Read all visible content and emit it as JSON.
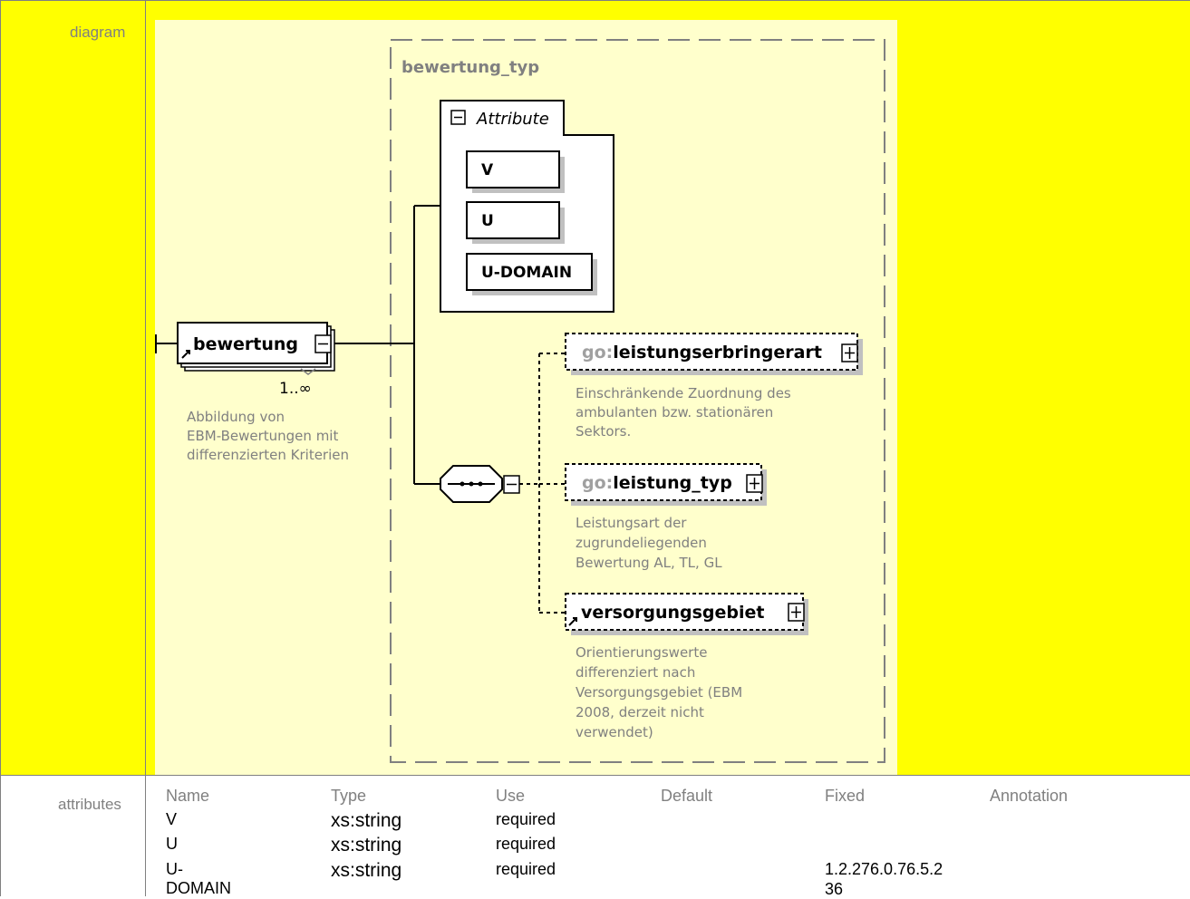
{
  "rows": {
    "diagram_label": "diagram",
    "attributes_label": "attributes"
  },
  "diagram": {
    "group_label": "bewertung_typ",
    "attribute_group_label": "Attribute",
    "attributes": [
      "V",
      "U",
      "U-DOMAIN"
    ],
    "root_element": "bewertung",
    "root_multiplicity": "1..∞",
    "root_annotation": [
      "Abbildung von",
      "EBM-Bewertungen mit",
      "differenzierten Kriterien"
    ],
    "children": [
      {
        "prefix": "go:",
        "name": "leistungserbringerart",
        "annotation": [
          "Einschränkende Zuordnung des",
          "ambulanten bzw. stationären",
          "Sektors."
        ]
      },
      {
        "prefix": "go:",
        "name": "leistung_typ",
        "annotation": [
          "Leistungsart der",
          "zugrundeliegenden",
          "Bewertung AL, TL, GL"
        ]
      },
      {
        "prefix": "",
        "name": "versorgungsgebiet",
        "annotation": [
          "Orientierungswerte",
          "differenziert nach",
          "Versorgungsgebiet (EBM",
          "2008, derzeit nicht",
          "verwendet)"
        ]
      }
    ],
    "colors": {
      "row_background": "#ffff00",
      "canvas_background": "#ffffcc",
      "annotation_text": "#808080"
    }
  },
  "attributes_table": {
    "headers": [
      "Name",
      "Type",
      "Use",
      "Default",
      "Fixed",
      "Annotation"
    ],
    "rows": [
      {
        "name": "V",
        "type": "xs:string",
        "use": "required",
        "default": "",
        "fixed_1": "",
        "fixed_2": "",
        "annotation": ""
      },
      {
        "name": "U",
        "type": "xs:string",
        "use": "required",
        "default": "",
        "fixed_1": "",
        "fixed_2": "",
        "annotation": ""
      },
      {
        "name": "U-DOMAIN",
        "type": "xs:string",
        "use": "required",
        "default": "",
        "fixed_1": "1.2.276.0.76.5.2",
        "fixed_2": "36",
        "annotation": ""
      }
    ]
  }
}
